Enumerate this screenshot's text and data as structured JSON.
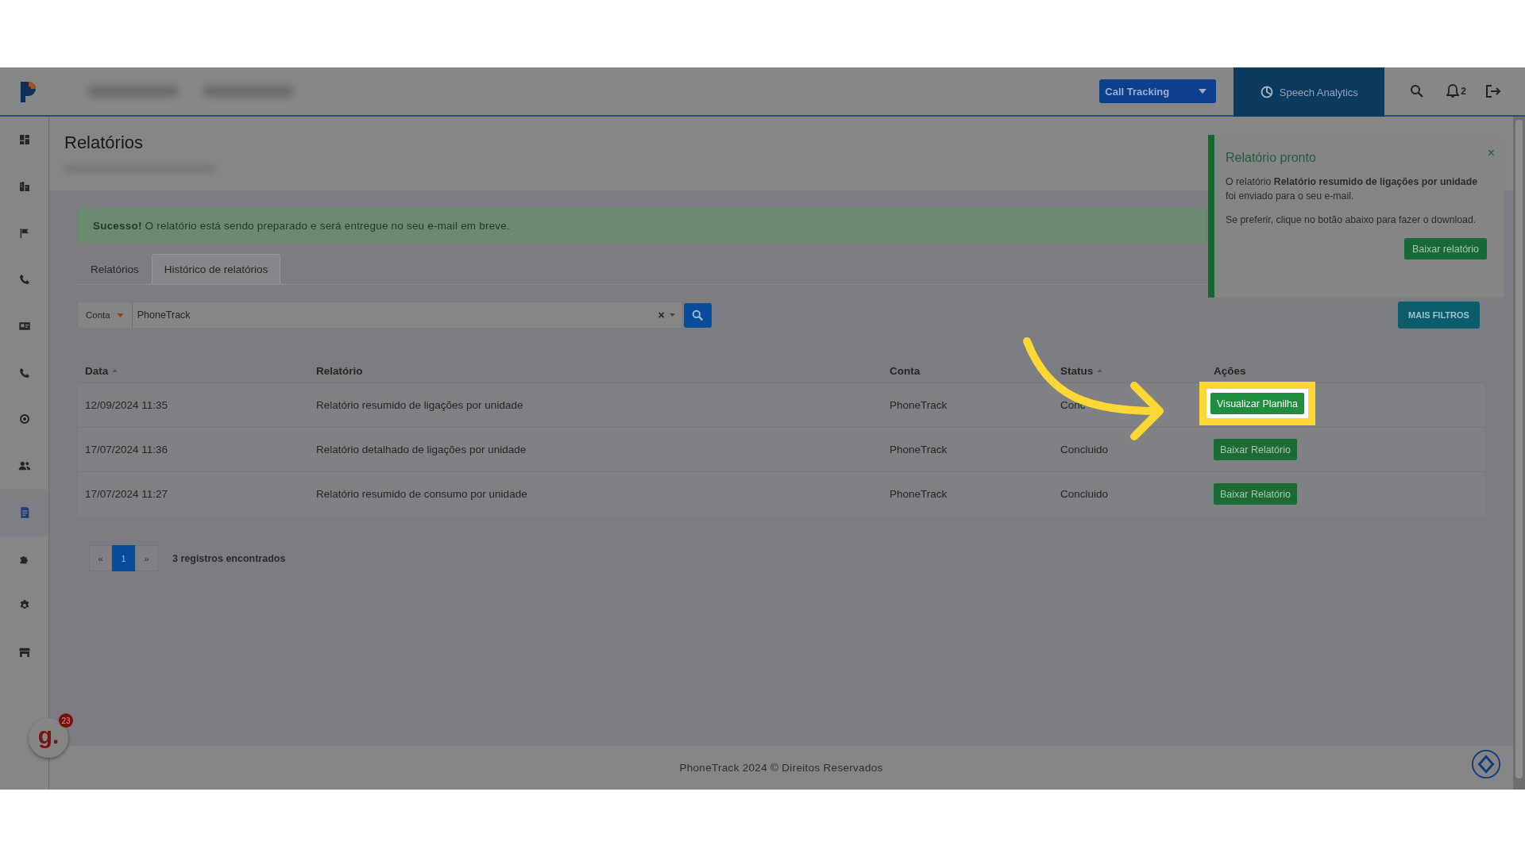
{
  "topbar": {
    "product_select": {
      "label": "Call Tracking"
    },
    "speech_analytics": {
      "label": "Speech Analytics"
    },
    "notifications": {
      "count": "2"
    }
  },
  "sidebar": {
    "items": [
      {
        "selected": false
      },
      {
        "selected": false
      },
      {
        "selected": false
      },
      {
        "selected": false
      },
      {
        "selected": false
      },
      {
        "selected": false
      },
      {
        "selected": false
      },
      {
        "selected": false
      },
      {
        "selected": true
      },
      {
        "selected": false
      },
      {
        "selected": false
      },
      {
        "selected": false
      }
    ]
  },
  "page": {
    "title": "Relatórios"
  },
  "alert": {
    "text": "**Sucesso!** O relatório está sendo preparado e será entregue no seu e-mail em breve."
  },
  "tabs": [
    {
      "label": "Relatórios",
      "selected": false
    },
    {
      "label": "Histórico de relatórios",
      "selected": true
    }
  ],
  "filter": {
    "field_label": "Conta",
    "value": "PhoneTrack",
    "clear": "×"
  },
  "more_filters_button": "MAIS FILTROS",
  "table": {
    "columns": [
      {
        "label": "Data",
        "sortable": true
      },
      {
        "label": "Relatório",
        "sortable": false
      },
      {
        "label": "Conta",
        "sortable": false
      },
      {
        "label": "Status",
        "sortable": true
      },
      {
        "label": "Ações",
        "sortable": false
      }
    ],
    "rows": [
      {
        "date": "12/09/2024 11:35",
        "report": "Relatório resumido de ligações por unidade",
        "account": "PhoneTrack",
        "status": "Conc",
        "action": {
          "label": "Visualizar Planilha",
          "highlighted": true
        }
      },
      {
        "date": "17/07/2024 11:36",
        "report": "Relatório detalhado de ligações por unidade",
        "account": "PhoneTrack",
        "status": "Concluido",
        "action": {
          "label": "Baixar Relatório",
          "highlighted": false
        }
      },
      {
        "date": "17/07/2024 11:27",
        "report": "Relatório resumido de consumo por unidade",
        "account": "PhoneTrack",
        "status": "Concluido",
        "action": {
          "label": "Baixar Relatório",
          "highlighted": false
        }
      }
    ]
  },
  "pagination": {
    "prev": "«",
    "pages": [
      {
        "label": "1",
        "selected": true
      }
    ],
    "next": "»",
    "summary": "3 registros encontrados"
  },
  "footer": "PhoneTrack 2024 © Direitos Reservados",
  "toast": {
    "title": "Relatório pronto",
    "message": "O relatório **Relatório resumido de ligações por unidade** foi enviado para o seu e-mail.",
    "hint": "Se preferir, clique no botão abaixo para fazer o download.",
    "button": "Baixar relatório",
    "close": "×"
  },
  "chat_widget": {
    "letter": "g.",
    "badge": "23"
  }
}
